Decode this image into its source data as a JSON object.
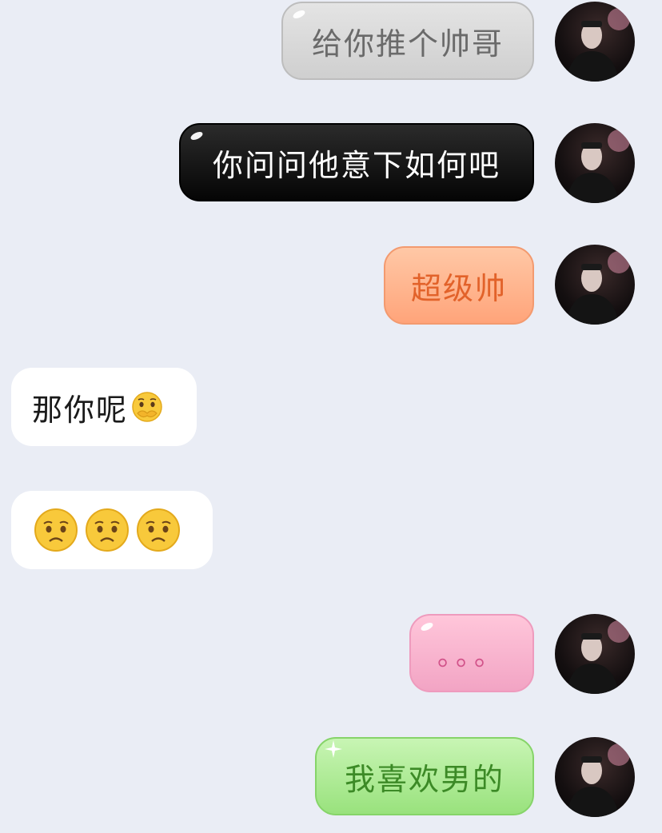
{
  "messages": [
    {
      "side": "right",
      "style": "gray",
      "text": "给你推个帅哥"
    },
    {
      "side": "right",
      "style": "black",
      "text": "你问问他意下如何吧"
    },
    {
      "side": "right",
      "style": "orange",
      "text": "超级帅"
    },
    {
      "side": "left",
      "style": "white",
      "text": "那你呢",
      "emoji": "pleading-face-emoji"
    },
    {
      "side": "left",
      "style": "white",
      "emojis": [
        "disappointed-face-emoji",
        "disappointed-face-emoji",
        "disappointed-face-emoji"
      ]
    },
    {
      "side": "right",
      "style": "pink",
      "text": "。。。"
    },
    {
      "side": "right",
      "style": "green",
      "text": "我喜欢男的"
    }
  ],
  "colors": {
    "background": "#eaedf5",
    "gray_bubble": "#d8d8d8",
    "black_bubble": "#111111",
    "orange_bubble": "#ffb48c",
    "pink_bubble": "#f7b2ce",
    "green_bubble": "#aeea93"
  }
}
